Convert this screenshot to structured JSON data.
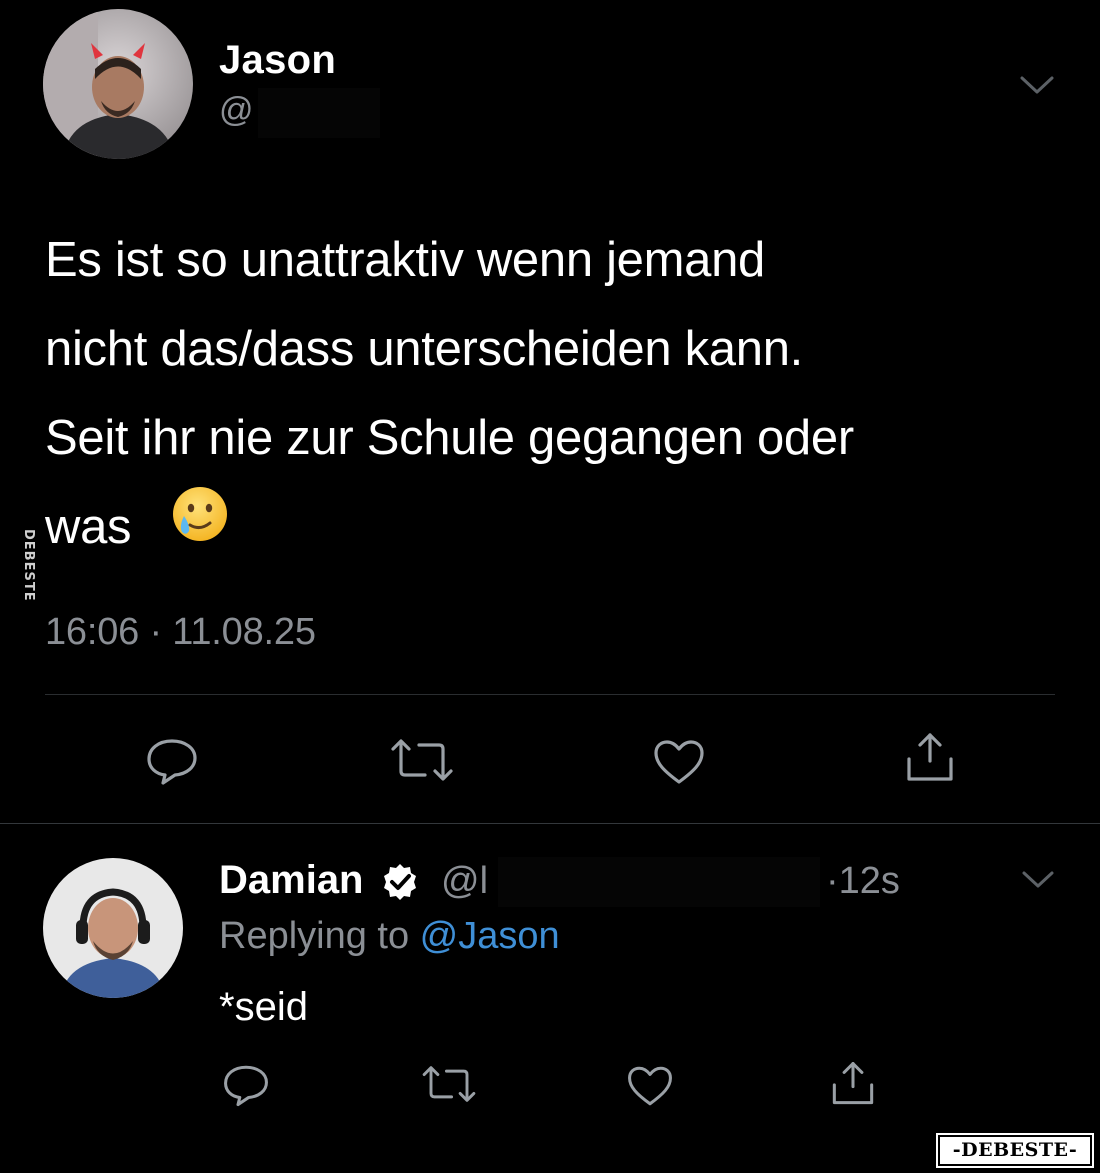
{
  "tweet": {
    "author_name": "Jason",
    "author_handle": "@",
    "text": "Es ist so unattraktiv wenn jemand\nnicht das/dass unterscheiden kann.\nSeit ihr nie zur Schule gegangen oder\nwas",
    "emoji": "face-holding-back-tears",
    "timestamp": "16:06 · 11.08.25",
    "actions": [
      "reply-icon",
      "retweet-icon",
      "like-icon",
      "share-icon"
    ]
  },
  "reply": {
    "author_name": "Damian",
    "verified": true,
    "author_handle": "@l",
    "time_ago": "·12s",
    "replying_prefix": "Replying to ",
    "replying_mention": "@Jason",
    "text": "*seid",
    "actions": [
      "reply-icon",
      "retweet-icon",
      "like-icon",
      "share-icon"
    ]
  },
  "colors": {
    "background": "#000000",
    "secondary_text": "#8b8f95",
    "mention": "#3f8fd6",
    "icon": "#8b8f95"
  },
  "watermarks": {
    "side": "DEBESTE",
    "corner": "-DEBESTE-"
  }
}
